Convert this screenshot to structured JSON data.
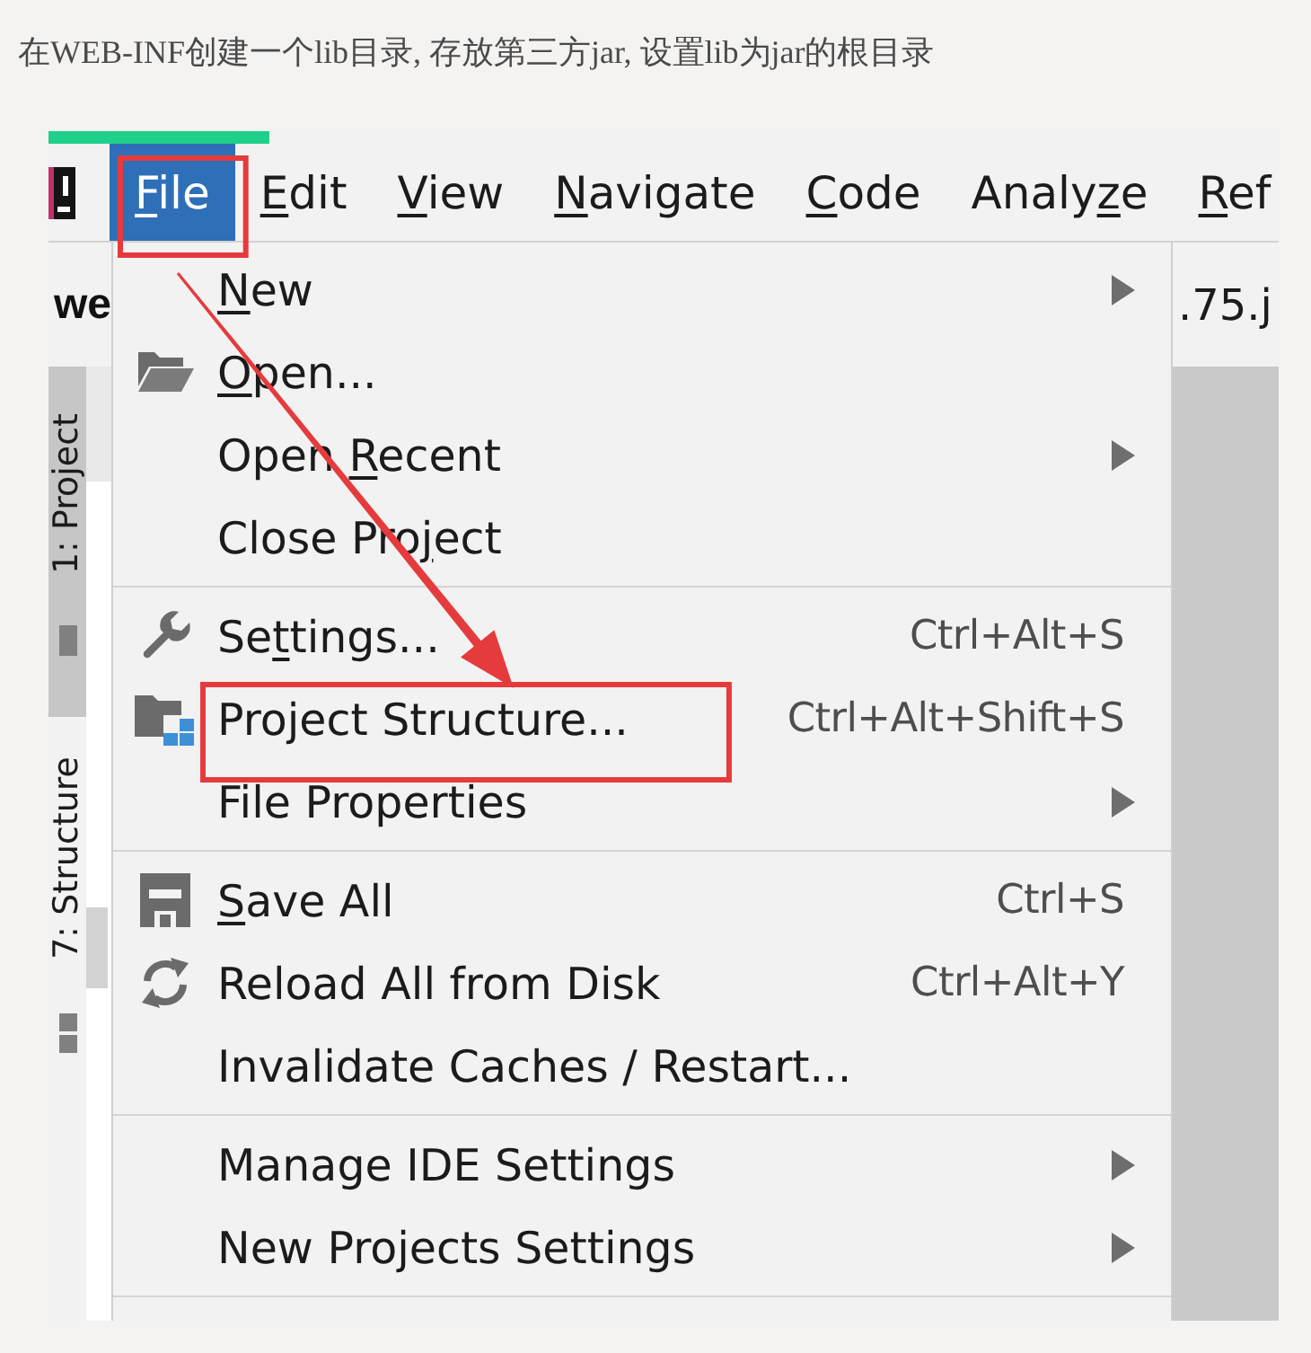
{
  "caption": "在WEB-INF创建一个lib目录, 存放第三方jar, 设置lib为jar的根目录",
  "screenshot": {
    "menu_bar": [
      {
        "label": [
          {
            "text": "F",
            "underlined": true
          },
          {
            "text": "ile",
            "underlined": false
          }
        ],
        "selected": true,
        "annotated": true
      },
      {
        "label": [
          {
            "text": "E",
            "underlined": true
          },
          {
            "text": "dit",
            "underlined": false
          }
        ],
        "selected": false,
        "annotated": false
      },
      {
        "label": [
          {
            "text": "V",
            "underlined": true
          },
          {
            "text": "iew",
            "underlined": false
          }
        ],
        "selected": false,
        "annotated": false
      },
      {
        "label": [
          {
            "text": "N",
            "underlined": true
          },
          {
            "text": "avigate",
            "underlined": false
          }
        ],
        "selected": false,
        "annotated": false
      },
      {
        "label": [
          {
            "text": "C",
            "underlined": true
          },
          {
            "text": "ode",
            "underlined": false
          }
        ],
        "selected": false,
        "annotated": false
      },
      {
        "label": [
          {
            "text": "Analy",
            "underlined": false
          },
          {
            "text": "z",
            "underlined": true
          },
          {
            "text": "e",
            "underlined": false
          }
        ],
        "selected": false,
        "annotated": false
      },
      {
        "label": [
          {
            "text": "R",
            "underlined": true
          },
          {
            "text": "ef",
            "underlined": false
          }
        ],
        "selected": false,
        "annotated": false
      }
    ],
    "project_name": "we",
    "editor_tab": ".75.j",
    "tool_stripe": [
      {
        "label": "1: Project",
        "selected": true
      },
      {
        "label": "7: Structure",
        "selected": false
      }
    ],
    "file_menu": [
      {
        "items": [
          {
            "label": [
              {
                "text": "N",
                "underlined": true
              },
              {
                "text": "ew",
                "underlined": false
              }
            ],
            "submenu": true,
            "annotated": false
          },
          {
            "label": [
              {
                "text": "O",
                "underlined": true
              },
              {
                "text": "pen...",
                "underlined": false
              }
            ],
            "submenu": false,
            "annotated": false
          },
          {
            "label": [
              {
                "text": "Open ",
                "underlined": false
              },
              {
                "text": "R",
                "underlined": true
              },
              {
                "text": "ecent",
                "underlined": false
              }
            ],
            "submenu": true,
            "annotated": false
          },
          {
            "label": [
              {
                "text": "Close Pro",
                "underlined": false
              },
              {
                "text": "j",
                "underlined": true
              },
              {
                "text": "ect",
                "underlined": false
              }
            ],
            "submenu": false,
            "annotated": false
          }
        ]
      },
      {
        "items": [
          {
            "label": [
              {
                "text": "Se",
                "underlined": false
              },
              {
                "text": "t",
                "underlined": true
              },
              {
                "text": "tings...",
                "underlined": false
              }
            ],
            "shortcut": "Ctrl+Alt+S",
            "submenu": false,
            "annotated": false
          },
          {
            "label": [
              {
                "text": "Project Structure...",
                "underlined": false
              }
            ],
            "shortcut": "Ctrl+Alt+Shift+S",
            "submenu": false,
            "annotated": true
          },
          {
            "label": [
              {
                "text": "File Properties",
                "underlined": false
              }
            ],
            "submenu": true,
            "annotated": false
          }
        ]
      },
      {
        "items": [
          {
            "label": [
              {
                "text": "S",
                "underlined": true
              },
              {
                "text": "ave All",
                "underlined": false
              }
            ],
            "shortcut": "Ctrl+S",
            "submenu": false,
            "annotated": false
          },
          {
            "label": [
              {
                "text": "Reload All from Disk",
                "underlined": false
              }
            ],
            "shortcut": "Ctrl+Alt+Y",
            "submenu": false,
            "annotated": false
          },
          {
            "label": [
              {
                "text": "Invalidate Caches / Restart...",
                "underlined": false
              }
            ],
            "submenu": false,
            "annotated": false
          }
        ]
      },
      {
        "items": [
          {
            "label": [
              {
                "text": "Manage IDE Settings",
                "underlined": false
              }
            ],
            "submenu": true,
            "annotated": false
          },
          {
            "label": [
              {
                "text": "New Projects Settings",
                "underlined": false
              }
            ],
            "submenu": true,
            "annotated": false
          }
        ]
      }
    ]
  }
}
